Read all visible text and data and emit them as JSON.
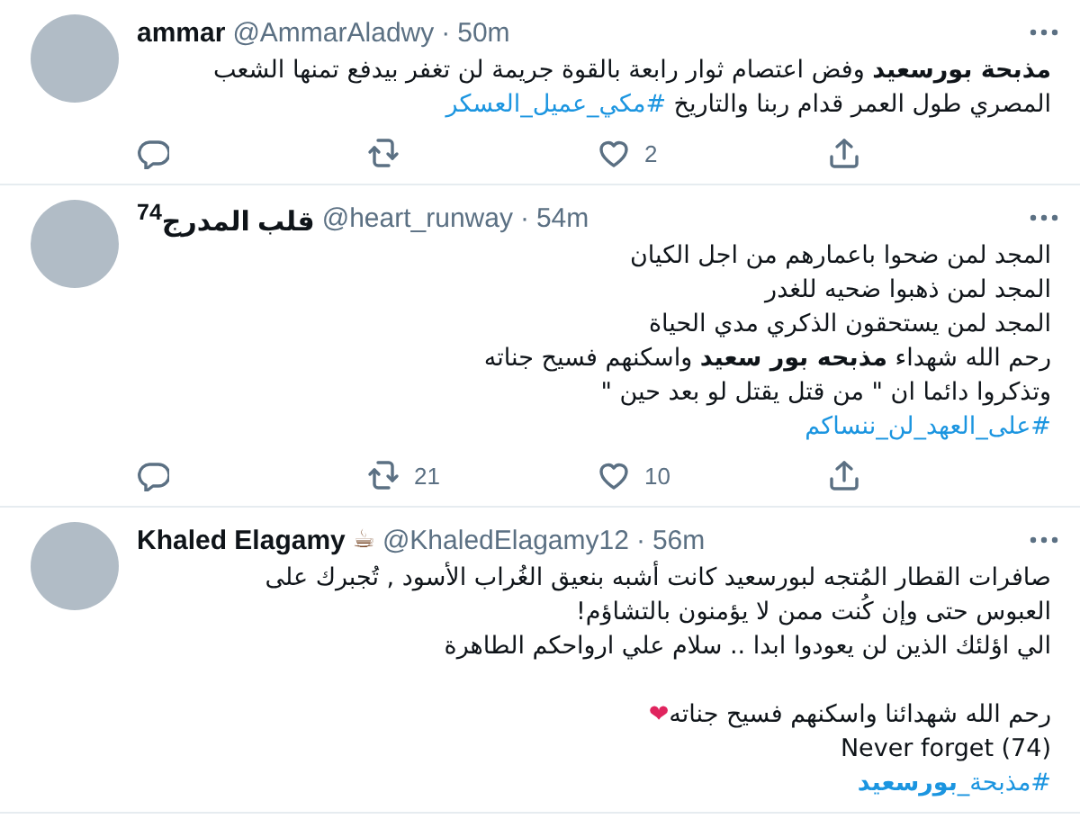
{
  "tweets": [
    {
      "name": "ammar",
      "handle": "@AmmarAladwy",
      "separator": "·",
      "time": "50m",
      "lines": [
        [
          {
            "kind": "text",
            "text": "**مذبحة بورسعيد** وفض اعتصام ثوار رابعة بالقوة جريمة لن تغفر بيدفع تمنها الشعب"
          }
        ],
        [
          {
            "kind": "text",
            "text": "المصري طول العمر قدام ربنا والتاريخ "
          },
          {
            "kind": "hashtag",
            "text": "#مكي_عميل_العسكر"
          }
        ]
      ],
      "like_count": "2"
    },
    {
      "name": "قلب المدرج$^{74}$",
      "handle": "@heart_runway",
      "separator": "·",
      "time": "54m",
      "lines": [
        [
          {
            "kind": "text",
            "text": "المجد لمن ضحوا باعمارهم من اجل الكيان"
          }
        ],
        [
          {
            "kind": "text",
            "text": "المجد لمن ذهبوا ضحيه للغدر"
          }
        ],
        [
          {
            "kind": "text",
            "text": "المجد لمن يستحقون الذكري مدي الحياة"
          }
        ],
        [
          {
            "kind": "text",
            "text": "رحم الله شهداء **مذبحه بور سعيد** واسكنهم فسيح جناته"
          }
        ],
        [
          {
            "kind": "text",
            "text": "وتذكروا دائما ان \" من قتل يقتل لو بعد حين \""
          }
        ],
        [
          {
            "kind": "hashtag",
            "text": "#على_العهد_لن_ننساكم"
          }
        ]
      ],
      "retweet_count": "21",
      "like_count": "10"
    },
    {
      "name": "Khaled Elagamy",
      "name_emoji": "☕",
      "handle": "@KhaledElagamy12",
      "separator": "·",
      "time": "56m",
      "lines": [
        [
          {
            "kind": "text",
            "text": "صافرات القطار المُتجه لبورسعيد كانت أشبه بنعيق الغُراب الأسود , تُجبرك على"
          }
        ],
        [
          {
            "kind": "text",
            "text": "العبوس حتى وإن كُنت ممن لا يؤمنون بالتشاؤم!"
          }
        ],
        [
          {
            "kind": "text",
            "text": "الي اؤلئك الذين لن يعودوا ابدا .. سلام علي ارواحكم الطاهرة"
          }
        ],
        [
          {
            "kind": "blank"
          }
        ],
        [
          {
            "kind": "text",
            "text": "رحم الله شهدائنا واسكنهم فسيح جناته"
          },
          {
            "kind": "emoji",
            "text": "❤"
          }
        ],
        [
          {
            "kind": "text",
            "text": "Never forget (74)"
          }
        ],
        [
          {
            "kind": "hashtag",
            "text": "#مذبحة_**بورسعيد**"
          }
        ]
      ]
    }
  ]
}
